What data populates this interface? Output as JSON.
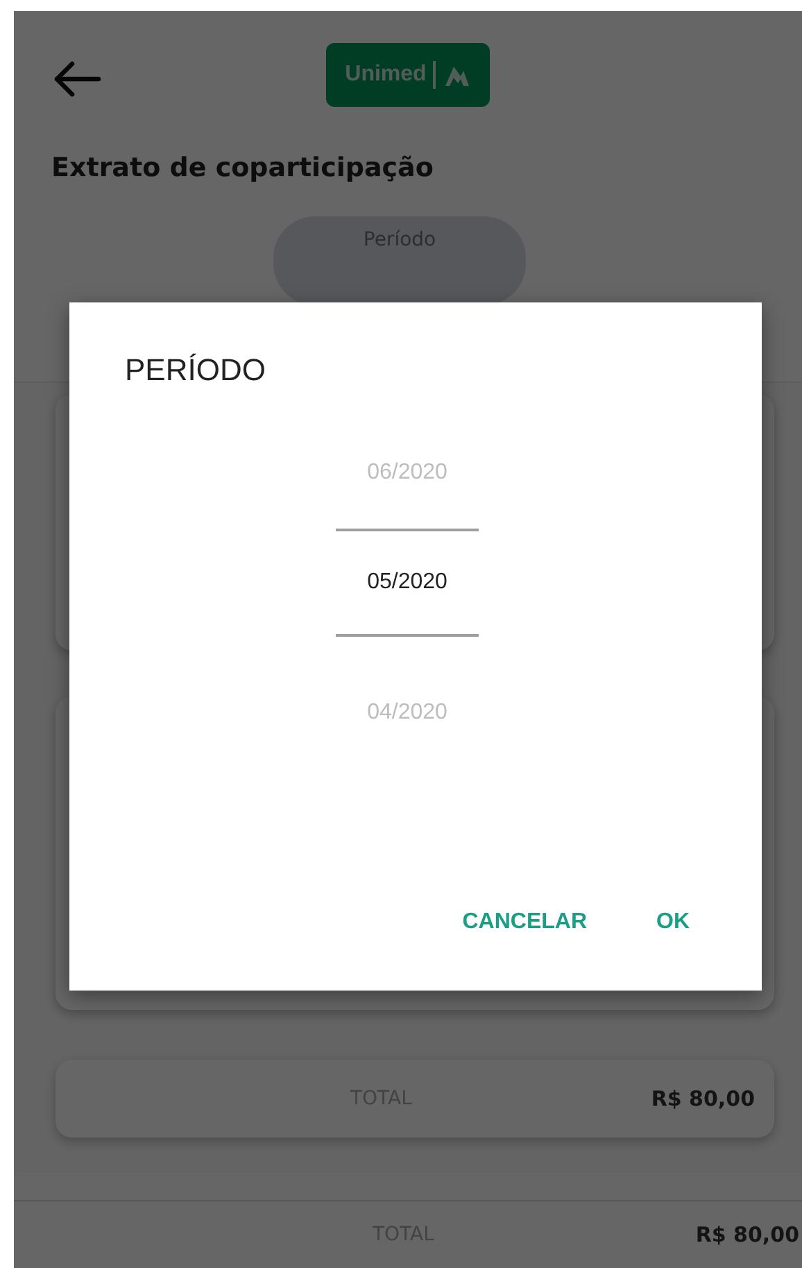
{
  "header": {
    "logo": "Unimed"
  },
  "page": {
    "title": "Extrato de coparticipação",
    "period_label": "Período"
  },
  "total_card": {
    "label": "TOTAL",
    "value": "R$ 80,00"
  },
  "footer": {
    "label": "TOTAL",
    "value": "R$ 80,00"
  },
  "dialog": {
    "title": "PERÍODO",
    "options": [
      {
        "label": "06/2020",
        "selected": false
      },
      {
        "label": "05/2020",
        "selected": true
      },
      {
        "label": "04/2020",
        "selected": false
      }
    ],
    "buttons": [
      "CANCELAR",
      "OK"
    ]
  }
}
